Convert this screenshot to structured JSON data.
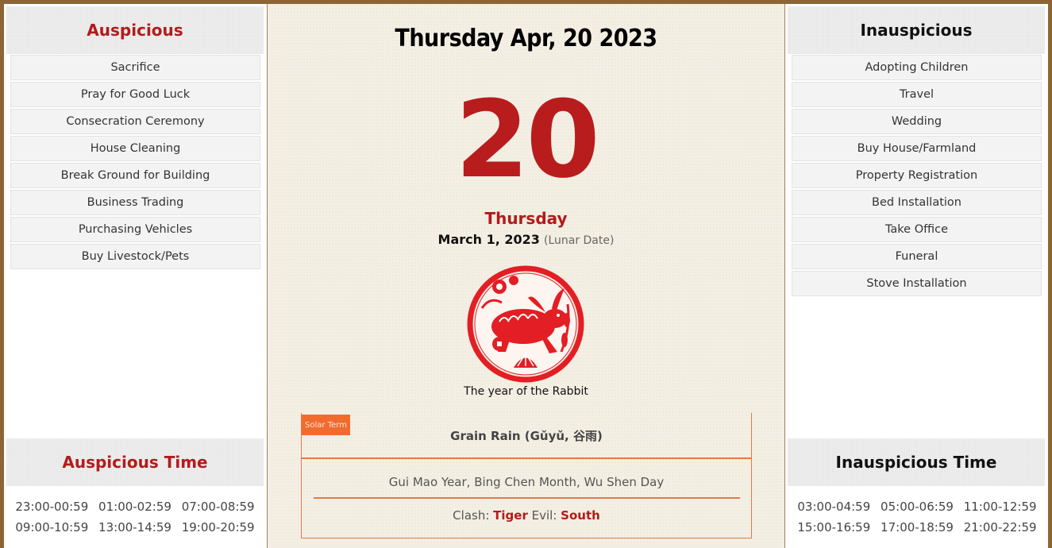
{
  "auspicious": {
    "title": "Auspicious",
    "activities": [
      "Sacrifice",
      "Pray for Good Luck",
      "Consecration Ceremony",
      "House Cleaning",
      "Break Ground for Building",
      "Business Trading",
      "Purchasing Vehicles",
      "Buy Livestock/Pets"
    ],
    "time_title": "Auspicious Time",
    "times": [
      "23:00-00:59",
      "01:00-02:59",
      "07:00-08:59",
      "09:00-10:59",
      "13:00-14:59",
      "19:00-20:59"
    ]
  },
  "inauspicious": {
    "title": "Inauspicious",
    "activities": [
      "Adopting Children",
      "Travel",
      "Wedding",
      "Buy House/Farmland",
      "Property Registration",
      "Bed Installation",
      "Take Office",
      "Funeral",
      "Stove Installation"
    ],
    "time_title": "Inauspicious Time",
    "times": [
      "03:00-04:59",
      "05:00-06:59",
      "11:00-12:59",
      "15:00-16:59",
      "17:00-18:59",
      "21:00-22:59"
    ]
  },
  "center": {
    "date_title": "Thursday Apr, 20 2023",
    "day_number": "20",
    "weekday": "Thursday",
    "lunar_date": "March 1, 2023",
    "lunar_label": "(Lunar Date)",
    "zodiac_icon": "rabbit-papercut-icon",
    "zodiac_caption": "The year of the Rabbit",
    "solar_term_badge": "Solar Term",
    "solar_term": "Grain Rain (Gǔyǔ, 谷雨)",
    "ganzhi": "Gui Mao Year, Bing Chen Month, Wu Shen Day",
    "clash_label": "Clash:",
    "clash_value": "Tiger",
    "evil_label": "Evil:",
    "evil_value": "South"
  },
  "colors": {
    "accent_red": "#b31b1b",
    "frame_brown": "#8f6434",
    "orange": "#f26b2e"
  }
}
